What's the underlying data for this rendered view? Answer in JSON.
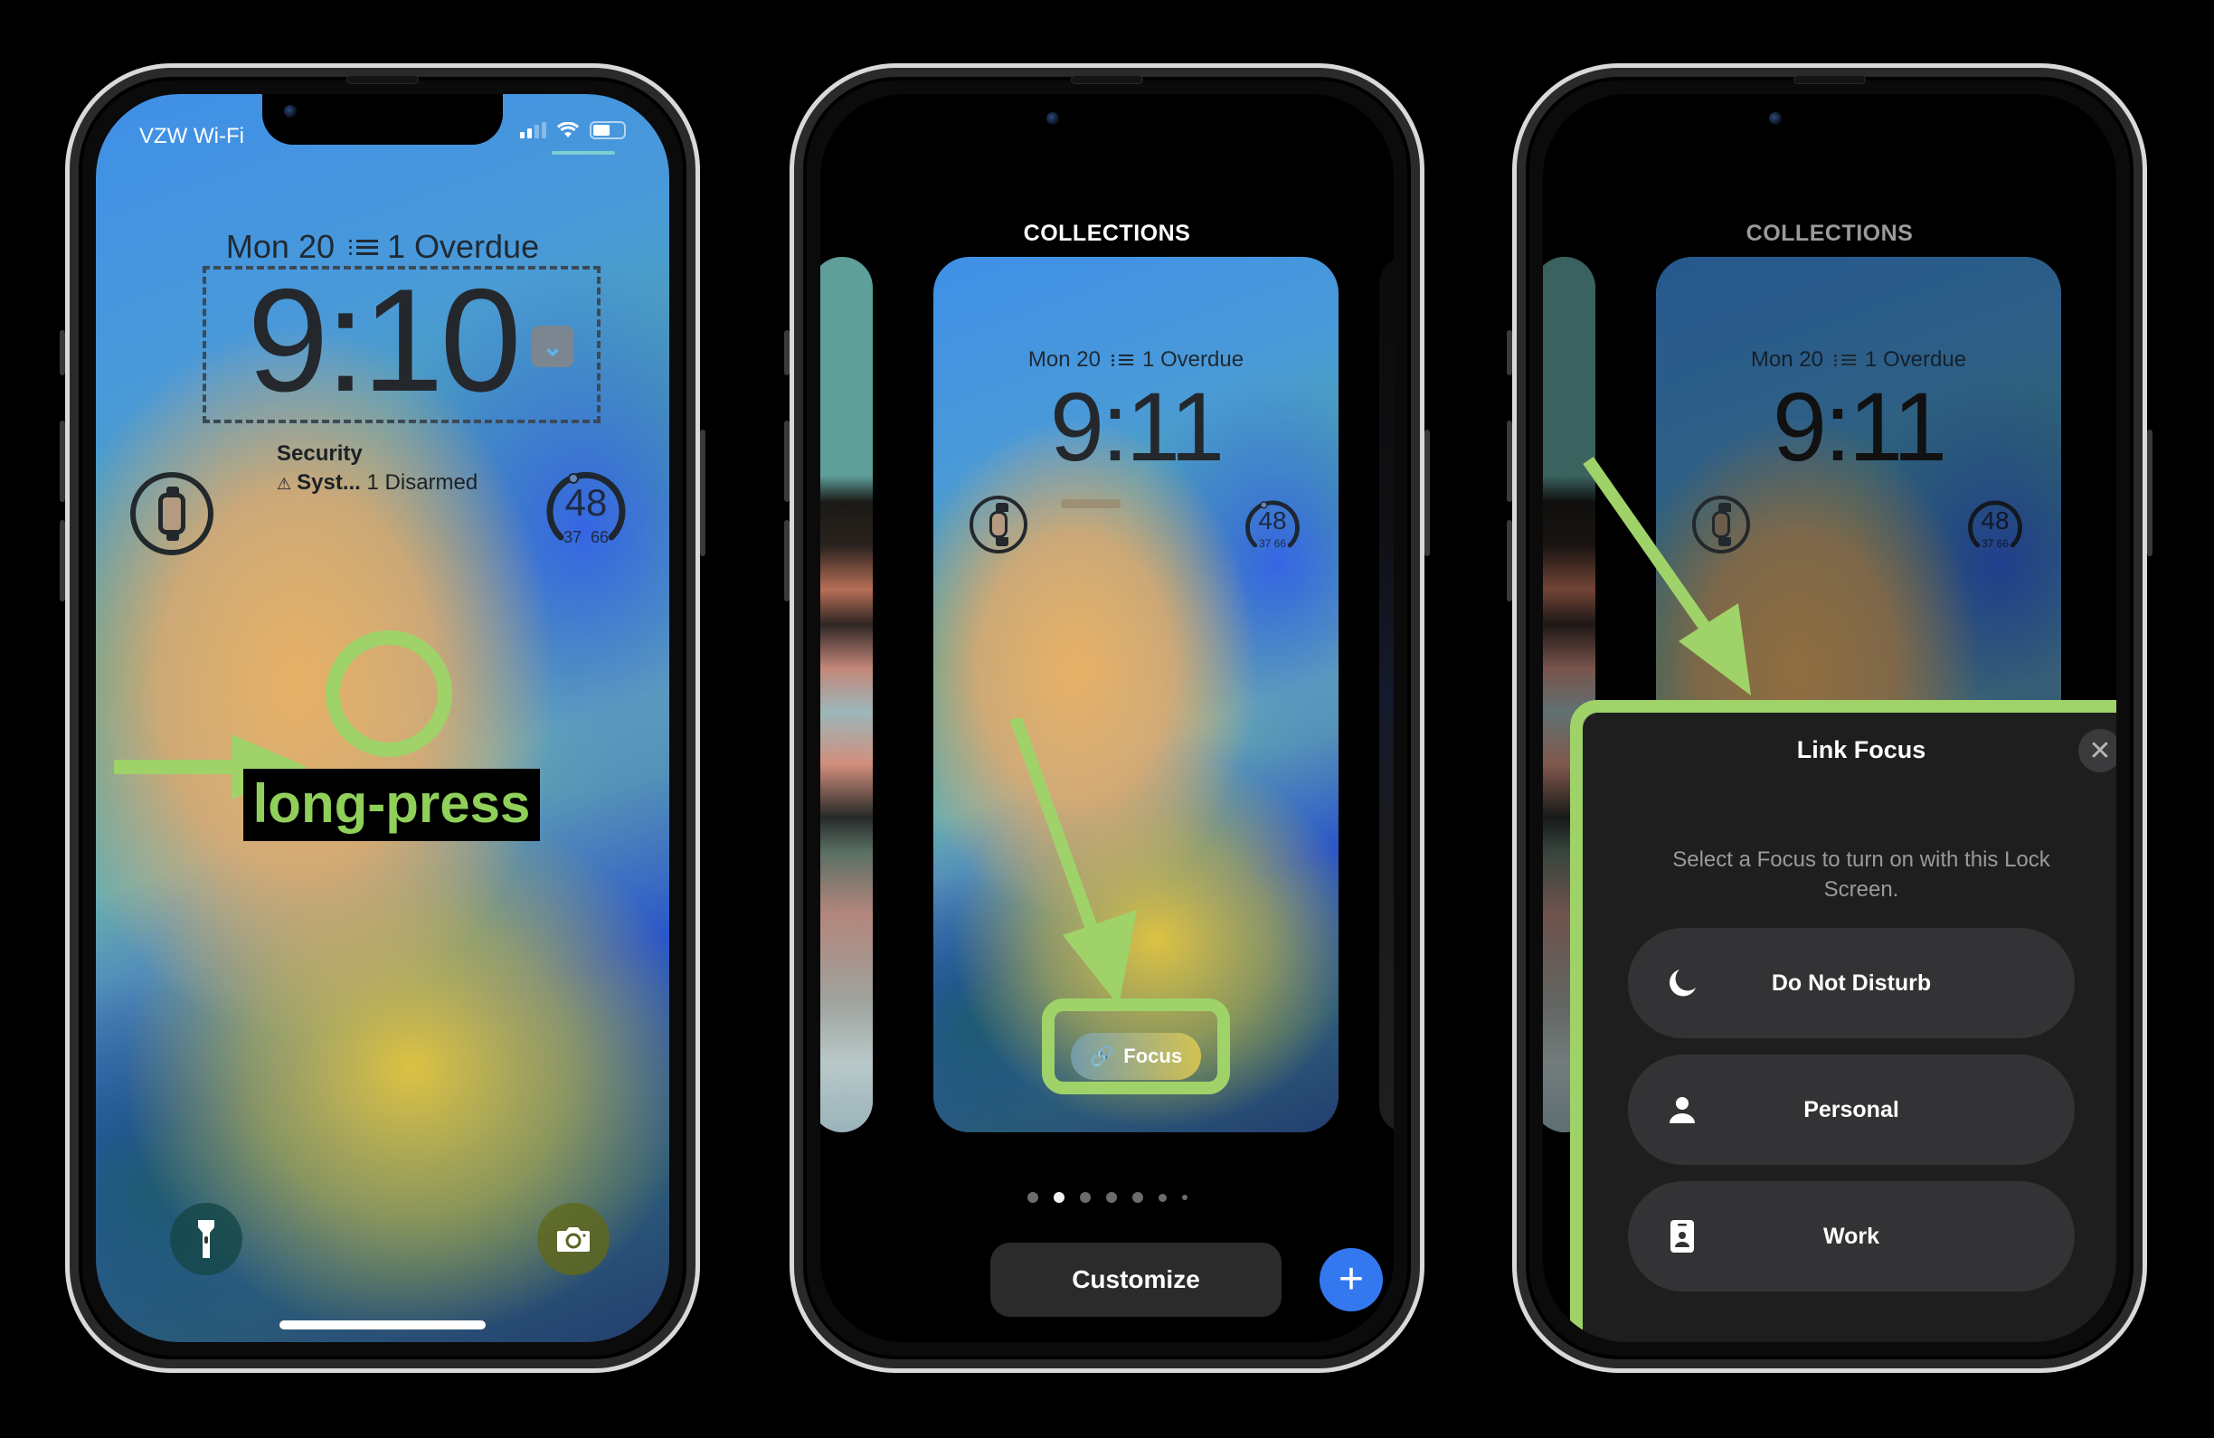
{
  "phone1": {
    "status_bar": {
      "carrier": "VZW Wi-Fi",
      "signal_bars": 2,
      "signal_total": 4,
      "wifi": "wifi-icon",
      "battery": "battery-icon"
    },
    "lock_screen": {
      "date": "Mon 20",
      "reminder": "1 Overdue",
      "time": "9:10",
      "widgets": {
        "watch": {
          "icon": "apple-watch-icon"
        },
        "security": {
          "title": "Security",
          "system": "Syst...",
          "status": "1 Disarmed",
          "icon": "siren-icon"
        },
        "weather": {
          "temp": "48",
          "low": "37",
          "high": "66"
        }
      },
      "quick_actions": {
        "left": "flashlight-icon",
        "right": "camera-icon"
      }
    },
    "annotation": {
      "label": "long-press",
      "color": "#9fd369"
    }
  },
  "phone2": {
    "header": "COLLECTIONS",
    "card": {
      "date": "Mon 20",
      "reminder": "1 Overdue",
      "time": "9:11",
      "weather": {
        "temp": "48",
        "low": "37",
        "high": "66"
      }
    },
    "focus_button": {
      "label": "Focus",
      "icon": "link-icon"
    },
    "pager": {
      "count": 7,
      "active_index": 1
    },
    "customize_label": "Customize",
    "add_label": "+"
  },
  "phone3": {
    "header": "COLLECTIONS",
    "card": {
      "date": "Mon 20",
      "reminder": "1 Overdue",
      "time": "9:11",
      "weather": {
        "temp": "48",
        "low": "37",
        "high": "66"
      }
    },
    "modal": {
      "title": "Link Focus",
      "close_icon": "close-icon",
      "description": "Select a Focus to turn on with this Lock Screen.",
      "options": [
        {
          "label": "Do Not Disturb",
          "icon": "moon-icon"
        },
        {
          "label": "Personal",
          "icon": "person-icon"
        },
        {
          "label": "Work",
          "icon": "id-badge-icon"
        }
      ]
    }
  },
  "colors": {
    "annotation_green": "#9fd369",
    "accent_blue": "#3478f0",
    "modal_bg": "#1e1e1e",
    "option_bg": "#333335"
  }
}
